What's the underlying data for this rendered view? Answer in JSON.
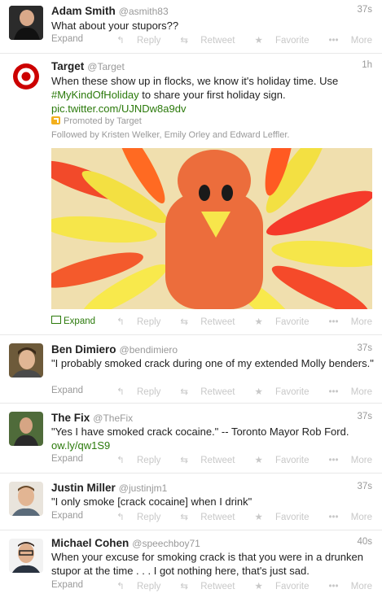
{
  "actions": {
    "reply": "Reply",
    "retweet": "Retweet",
    "favorite": "Favorite",
    "more": "More",
    "expand": "Expand"
  },
  "tweets": [
    {
      "name": "Adam Smith",
      "handle": "@asmith83",
      "time": "37s",
      "text": "What about your stupors??"
    },
    {
      "name": "Target",
      "handle": "@Target",
      "time": "1h",
      "text_pre": "When these show up in flocks, we know it's holiday time. Use ",
      "hashtag": "#MyKindOfHoliday",
      "text_post": " to share your first holiday sign.",
      "link": "pic.twitter.com/UJNDw8a9dv",
      "promoted": "Promoted by Target",
      "followed": "Followed by Kristen Welker, Emily Orley and Edward Leffler."
    },
    {
      "name": "Ben Dimiero",
      "handle": "@bendimiero",
      "time": "37s",
      "text": "\"I probably smoked crack during one of my extended Molly benders.\""
    },
    {
      "name": "The Fix",
      "handle": "@TheFix",
      "time": "37s",
      "text": "\"Yes I have smoked crack cocaine.\" --  Toronto Mayor Rob Ford.",
      "link": "ow.ly/qw1S9"
    },
    {
      "name": "Justin Miller",
      "handle": "@justinjm1",
      "time": "37s",
      "text": "\"I only smoke [crack cocaine] when I drink\""
    },
    {
      "name": "Michael Cohen",
      "handle": "@speechboy71",
      "time": "40s",
      "text": "When your excuse for smoking crack is that you were in a drunken stupor at the time . . . I got nothing here, that's just sad."
    }
  ]
}
